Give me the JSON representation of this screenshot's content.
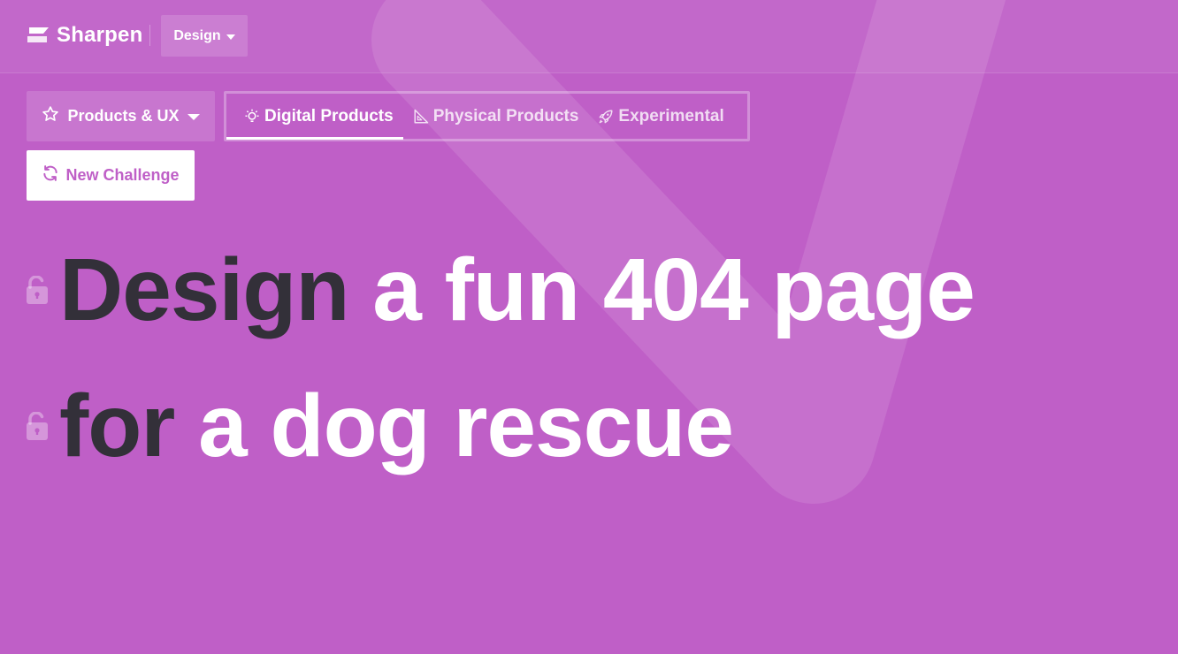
{
  "colors": {
    "background": "#bf5fc7",
    "text_dark": "#333039",
    "text_light": "#ffffff"
  },
  "header": {
    "brand": {
      "name": "Sharpen",
      "logo_icon": "sharpen-logo-icon"
    },
    "discipline": {
      "label": "Design",
      "icon": "caret-down-icon"
    }
  },
  "controls": {
    "category": {
      "label": "Products & UX",
      "icon": "star-icon",
      "caret": "caret-down-icon"
    },
    "tabs": [
      {
        "label": "Digital Products",
        "icon": "lightbulb-icon",
        "active": true
      },
      {
        "label": "Physical Products",
        "icon": "set-square-icon",
        "active": false
      },
      {
        "label": "Experimental",
        "icon": "rocket-icon",
        "active": false
      }
    ],
    "new_challenge": {
      "label": "New Challenge",
      "icon": "refresh-icon"
    }
  },
  "challenge": {
    "line1": {
      "verb": "Design",
      "rest": " a fun 404 page"
    },
    "line2": {
      "verb": "for",
      "rest": " a dog rescue"
    },
    "lock_icon": "unlock-icon"
  }
}
